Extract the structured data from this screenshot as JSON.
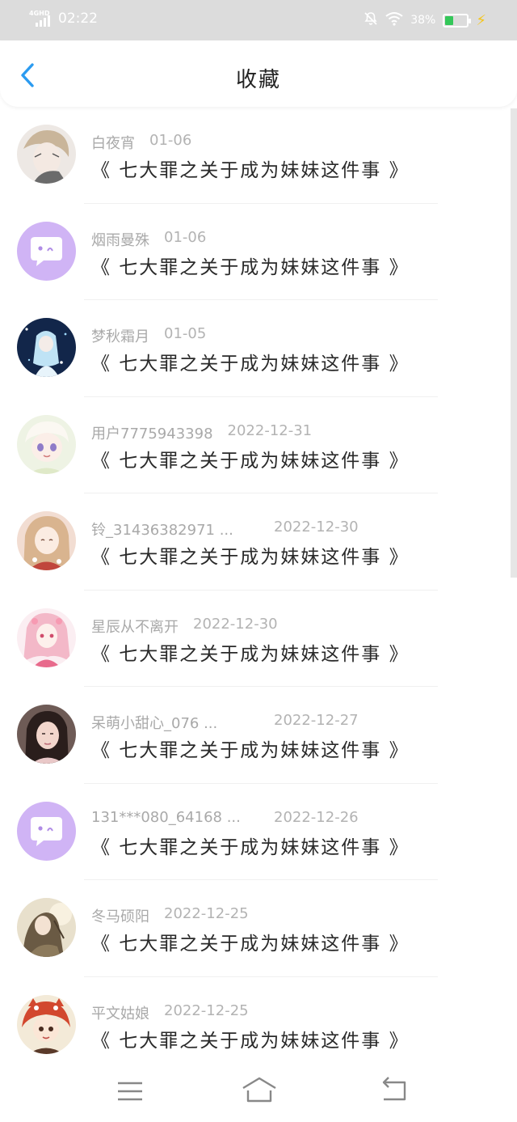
{
  "status_bar": {
    "network": "4GHD",
    "time": "02:22",
    "battery_percent": "38%",
    "battery_level": 0.38,
    "icons": [
      "signal-icon",
      "mute-icon",
      "wifi-icon",
      "battery-icon",
      "charging-icon"
    ]
  },
  "header": {
    "title": "收藏",
    "back_icon": "chevron-left-icon"
  },
  "colors": {
    "accent": "#2b9bf0",
    "status_bar_bg": "#dcdcdc",
    "meta_text": "#a9a9a9",
    "title_text": "#2a2a2a",
    "default_avatar_bg": "#d0b4f5"
  },
  "items": [
    {
      "username": "白夜宵",
      "date": "01-06",
      "title": "《 七大罪之关于成为妹妹这件事 》",
      "avatar": "anime-avatar"
    },
    {
      "username": "烟雨曼殊",
      "date": "01-06",
      "title": "《 七大罪之关于成为妹妹这件事 》",
      "avatar": "default-chat-avatar"
    },
    {
      "username": "梦秋霜月",
      "date": "01-05",
      "title": "《 七大罪之关于成为妹妹这件事 》",
      "avatar": "anime-avatar"
    },
    {
      "username": "用户7775943398",
      "date": "2022-12-31",
      "title": "《 七大罪之关于成为妹妹这件事 》",
      "avatar": "anime-avatar"
    },
    {
      "username": "铃_31436382971 ...",
      "date": "2022-12-30",
      "title": "《 七大罪之关于成为妹妹这件事 》",
      "avatar": "anime-avatar"
    },
    {
      "username": "星辰从不离开",
      "date": "2022-12-30",
      "title": "《 七大罪之关于成为妹妹这件事 》",
      "avatar": "anime-avatar"
    },
    {
      "username": "呆萌小甜心_076 ...",
      "date": "2022-12-27",
      "title": "《 七大罪之关于成为妹妹这件事 》",
      "avatar": "photo-avatar"
    },
    {
      "username": "131***080_64168 ...",
      "date": "2022-12-26",
      "title": "《 七大罪之关于成为妹妹这件事 》",
      "avatar": "default-chat-avatar"
    },
    {
      "username": "冬马硕阳",
      "date": "2022-12-25",
      "title": "《 七大罪之关于成为妹妹这件事 》",
      "avatar": "anime-avatar"
    },
    {
      "username": "平文姑娘",
      "date": "2022-12-25",
      "title": "《 七大罪之关于成为妹妹这件事 》",
      "avatar": "anime-avatar"
    }
  ],
  "nav_bar": {
    "buttons": [
      "menu-icon",
      "home-icon",
      "back-icon"
    ]
  }
}
